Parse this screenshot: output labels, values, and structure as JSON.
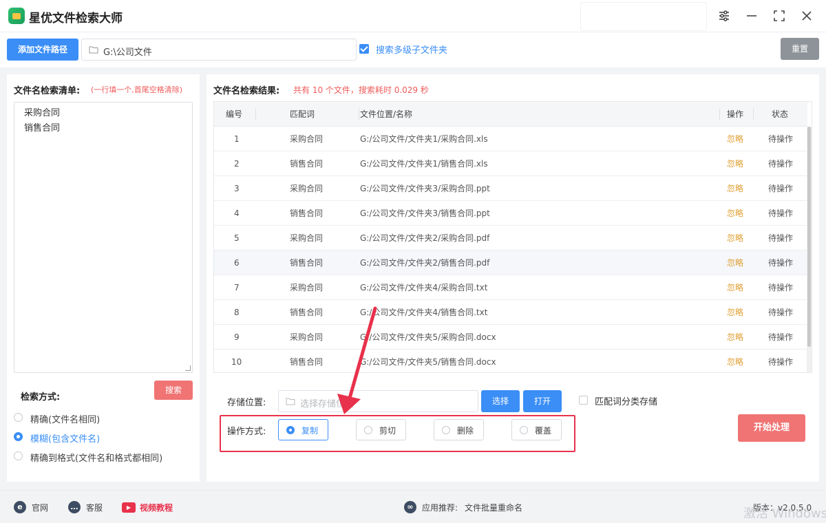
{
  "app": {
    "title": "星优文件检索大师"
  },
  "toolbar": {
    "add_path_label": "添加文件路径",
    "path_value": "G:\\公司文件",
    "subfolder_label": "搜索多级子文件夹",
    "subfolder_checked": true,
    "reset_label": "重置"
  },
  "left": {
    "heading": "文件名检索清单:",
    "hint": "(一行填一个,首尾空格清除)",
    "names": [
      "采购合同",
      "销售合同"
    ],
    "mode_title": "检索方式:",
    "search_label": "搜索",
    "modes": [
      {
        "label": "精确(文件名相同)",
        "selected": false
      },
      {
        "label": "模糊(包含文件名)",
        "selected": true
      },
      {
        "label": "精确到格式(文件名和格式都相同)",
        "selected": false
      }
    ]
  },
  "results": {
    "heading": "文件名检索结果:",
    "summary": "共有 10 个文件，搜索耗时 0.029 秒",
    "columns": {
      "no": "编号",
      "match": "匹配词",
      "path": "文件位置/名称",
      "op": "操作",
      "status": "状态"
    },
    "rows": [
      {
        "no": "1",
        "match": "采购合同",
        "path": "G:/公司文件/文件夹1/采购合同.xls",
        "op": "忽略",
        "status": "待操作"
      },
      {
        "no": "2",
        "match": "销售合同",
        "path": "G:/公司文件/文件夹1/销售合同.xls",
        "op": "忽略",
        "status": "待操作"
      },
      {
        "no": "3",
        "match": "采购合同",
        "path": "G:/公司文件/文件夹3/采购合同.ppt",
        "op": "忽略",
        "status": "待操作"
      },
      {
        "no": "4",
        "match": "销售合同",
        "path": "G:/公司文件/文件夹3/销售合同.ppt",
        "op": "忽略",
        "status": "待操作"
      },
      {
        "no": "5",
        "match": "采购合同",
        "path": "G:/公司文件/文件夹2/采购合同.pdf",
        "op": "忽略",
        "status": "待操作"
      },
      {
        "no": "6",
        "match": "销售合同",
        "path": "G:/公司文件/文件夹2/销售合同.pdf",
        "op": "忽略",
        "status": "待操作"
      },
      {
        "no": "7",
        "match": "采购合同",
        "path": "G:/公司文件/文件夹4/采购合同.txt",
        "op": "忽略",
        "status": "待操作"
      },
      {
        "no": "8",
        "match": "销售合同",
        "path": "G:/公司文件/文件夹4/销售合同.txt",
        "op": "忽略",
        "status": "待操作"
      },
      {
        "no": "9",
        "match": "采购合同",
        "path": "G:/公司文件/文件夹5/采购合同.docx",
        "op": "忽略",
        "status": "待操作"
      },
      {
        "no": "10",
        "match": "销售合同",
        "path": "G:/公司文件/文件夹5/销售合同.docx",
        "op": "忽略",
        "status": "待操作"
      }
    ],
    "highlighted_row": 6
  },
  "save": {
    "label": "存储位置:",
    "placeholder": "选择存储位置",
    "choose_label": "选择",
    "open_label": "打开",
    "classify_label": "匹配词分类存储"
  },
  "operation": {
    "label": "操作方式:",
    "options": [
      {
        "label": "复制",
        "selected": true
      },
      {
        "label": "剪切",
        "selected": false
      },
      {
        "label": "删除",
        "selected": false
      },
      {
        "label": "覆盖",
        "selected": false
      }
    ],
    "start_label": "开始处理"
  },
  "footer": {
    "official": "官网",
    "service": "客服",
    "video": "视频教程",
    "recommend_label": "应用推荐:",
    "recommend_app": "文件批量重命名",
    "version": "版本：v2.0.5.0"
  },
  "watermark": "激活 Windows",
  "colors": {
    "primary": "#3a8ef6",
    "danger": "#f07474",
    "warning": "#e0a035",
    "annotation": "#e8314b"
  },
  "icons": [
    "app-logo-icon",
    "settings-sliders-icon",
    "minimize-icon",
    "maximize-icon",
    "close-icon",
    "folder-icon",
    "checkbox-icon",
    "ie-icon",
    "chat-icon",
    "video-icon",
    "link-icon"
  ]
}
